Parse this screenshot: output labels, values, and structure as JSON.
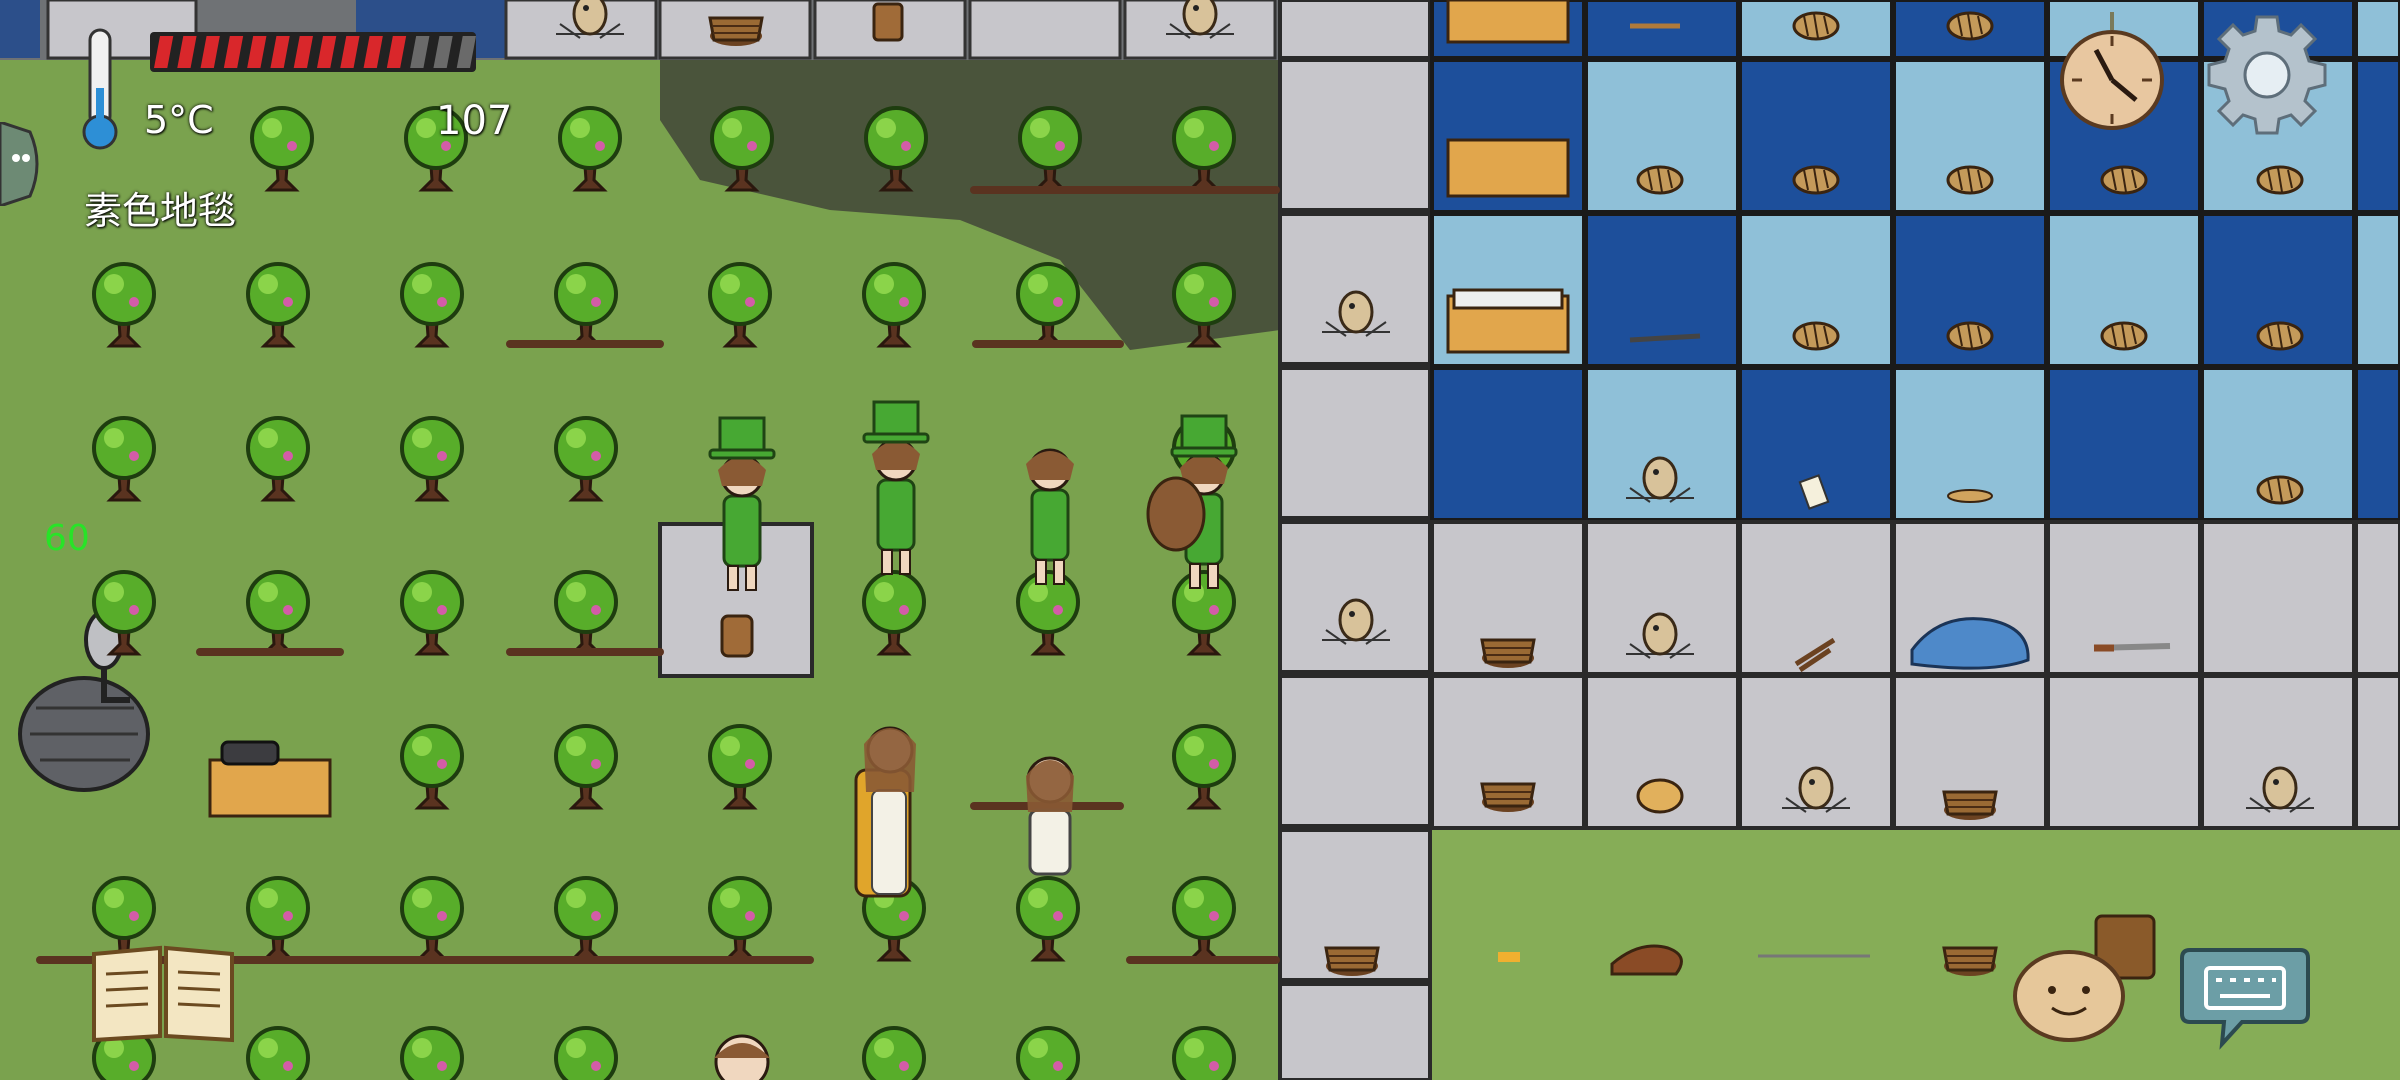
{
  "hud": {
    "temperature": "5°C",
    "food_count": "107",
    "held_item": "素色地毯",
    "fps": "60",
    "health_filled": 11,
    "health_total": 14
  },
  "icons": {
    "thermometer": "thermometer-icon",
    "settings": "gear-icon",
    "clock": "clock-icon",
    "book": "tech-tree-book-icon",
    "keyboard": "keyboard-chat-icon",
    "emote": "emote-face-icon",
    "left_tab": "side-tab-icon"
  },
  "colors": {
    "grass": "#7da451",
    "floor_stone": "#c7c6cb",
    "carpet_dark": "#1d4f9b",
    "carpet_light": "#8fc0d8",
    "health_red": "#d9272b",
    "fps_green": "#27e427",
    "tree_leaf": "#5cb32a"
  }
}
